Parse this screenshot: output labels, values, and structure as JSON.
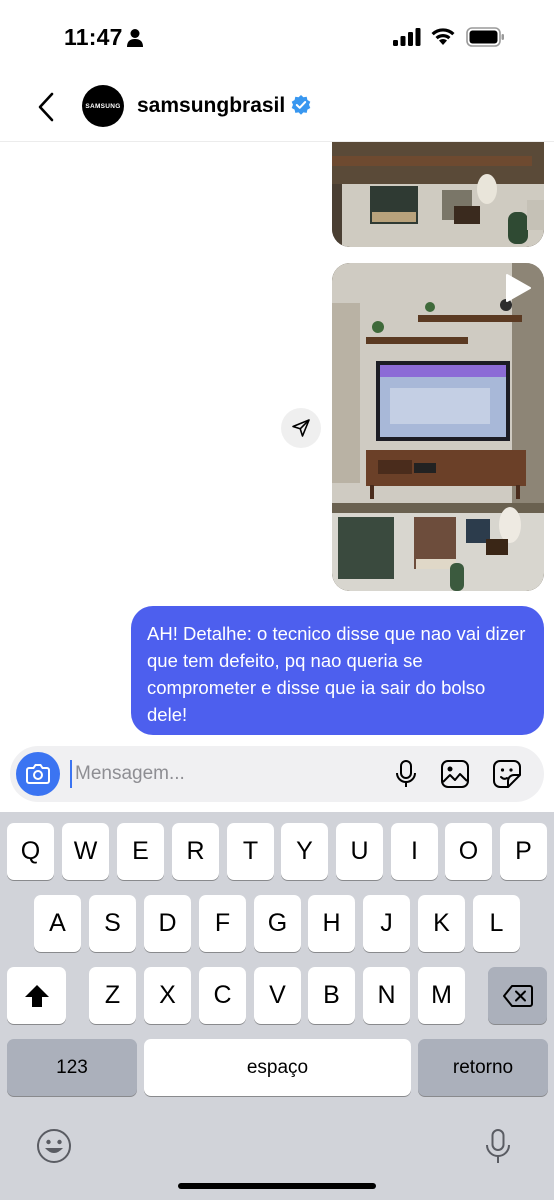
{
  "status_bar": {
    "time": "11:47"
  },
  "header": {
    "avatar_text": "SAMSUNG",
    "name": "samsungbrasil"
  },
  "message": {
    "text": "AH! Detalhe: o tecnico disse que nao vai dizer que tem defeito, pq nao queria se comprometer e disse que ia sair do bolso dele!"
  },
  "composer": {
    "placeholder": "Mensagem..."
  },
  "keyboard": {
    "row1": [
      "Q",
      "W",
      "E",
      "R",
      "T",
      "Y",
      "U",
      "I",
      "O",
      "P"
    ],
    "row2": [
      "A",
      "S",
      "D",
      "F",
      "G",
      "H",
      "J",
      "K",
      "L"
    ],
    "row3": [
      "Z",
      "X",
      "C",
      "V",
      "B",
      "N",
      "M"
    ],
    "numbers_label": "123",
    "space_label": "espaço",
    "return_label": "retorno"
  },
  "colors": {
    "accent": "#4d5fee",
    "camera": "#3b74f2",
    "verified": "#3897f0",
    "keyboard_bg": "#d1d3d9"
  }
}
